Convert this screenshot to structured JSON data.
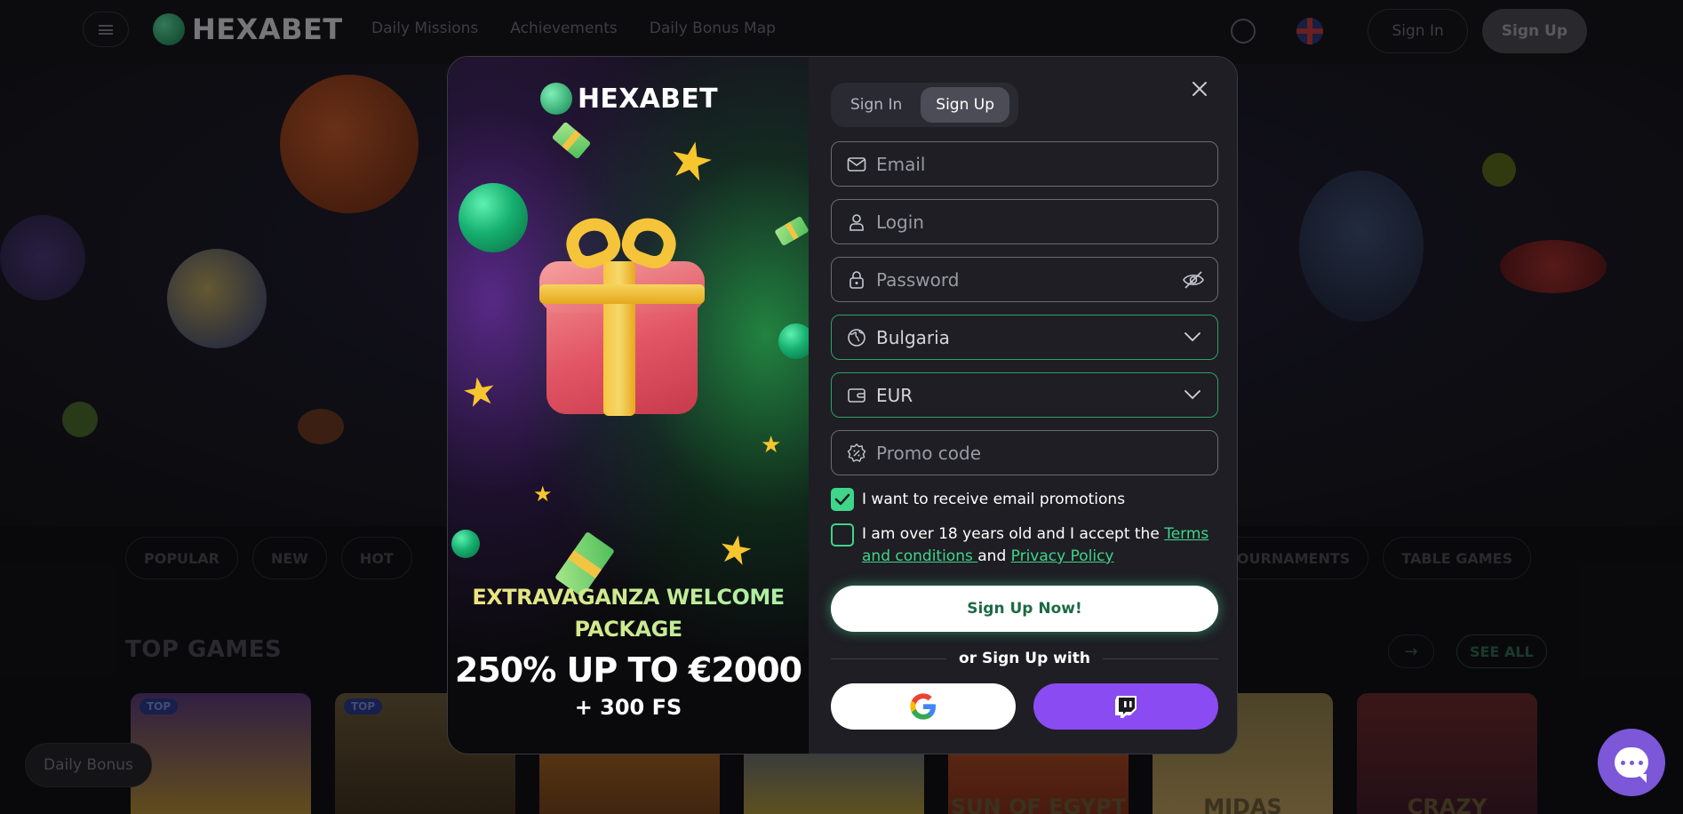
{
  "topbar": {
    "brand": "HEXABET",
    "nav": [
      "Daily Missions",
      "Achievements",
      "Daily Bonus Map"
    ],
    "sign_in": "Sign In",
    "sign_up": "Sign Up"
  },
  "categories_left": [
    "POPULAR",
    "NEW",
    "HOT"
  ],
  "categories_right": [
    "TOURNAMENTS",
    "TABLE GAMES"
  ],
  "top_games": {
    "title": "TOP GAMES",
    "see_all": "SEE ALL",
    "arrow": "→",
    "tiles": [
      {
        "badge": "TOP",
        "name": ""
      },
      {
        "badge": "TOP",
        "name": ""
      },
      {
        "badge": "",
        "name": ""
      },
      {
        "badge": "",
        "name": ""
      },
      {
        "badge": "",
        "name": "SUN OF EGYPT"
      },
      {
        "badge": "",
        "name": "MIDAS"
      },
      {
        "badge": "",
        "name": "CRAZY"
      }
    ]
  },
  "daily_bonus": "Daily Bonus",
  "modal": {
    "promo": {
      "brand": "HEXABET",
      "line1": "EXTRAVAGANZA WELCOME PACKAGE",
      "line2": "250% UP TO €2000",
      "line3": "+ 300 FS"
    },
    "tabs": {
      "sign_in": "Sign In",
      "sign_up": "Sign Up"
    },
    "fields": {
      "email_placeholder": "Email",
      "login_placeholder": "Login",
      "password_placeholder": "Password",
      "country_value": "Bulgaria",
      "currency_value": "EUR",
      "promo_placeholder": "Promo code"
    },
    "checkboxes": {
      "email_promotions": {
        "label": "I want to receive email promotions",
        "checked": true
      },
      "age_terms": {
        "text_before": "I am over 18 years old and I accept the ",
        "terms_link": "Terms and conditions ",
        "and": "and ",
        "privacy_link": "Privacy Policy",
        "checked": false
      }
    },
    "submit": "Sign Up Now!",
    "or_text": "or Sign Up with",
    "social": [
      "google-icon",
      "twitch-icon"
    ]
  },
  "colors": {
    "accent_green": "#3fd58a",
    "twitch_purple": "#8a4bf2",
    "chat_purple": "#7c57d8",
    "modal_form_bg": "#1e1e24"
  }
}
